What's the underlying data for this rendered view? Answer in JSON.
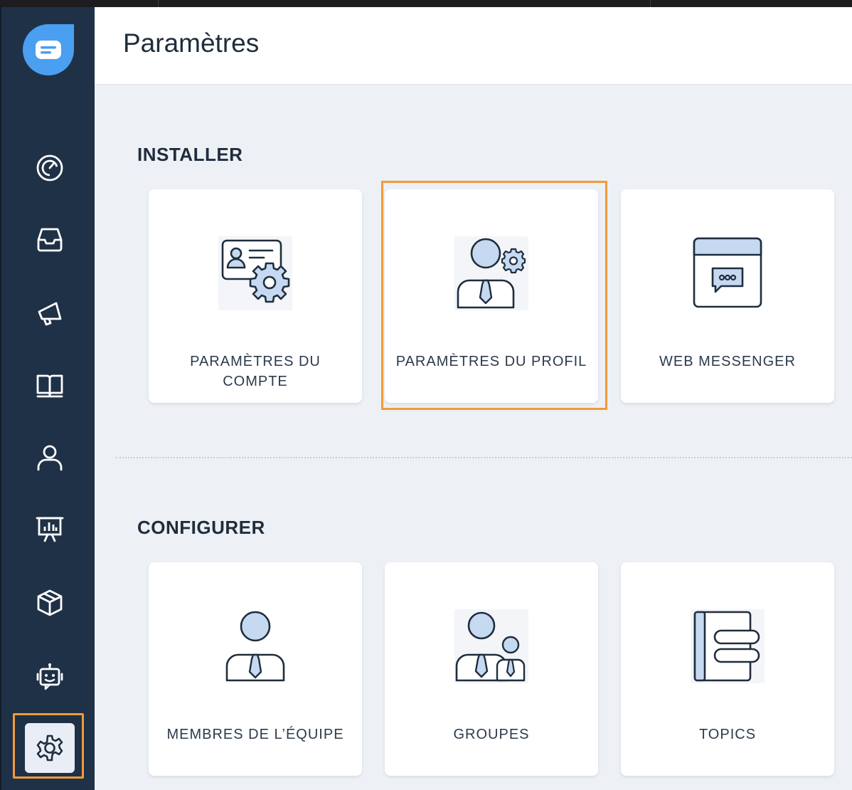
{
  "page": {
    "title": "Paramètres"
  },
  "sidebar": {
    "items": [
      {
        "id": "dashboard",
        "icon": "dashboard-gauge-icon"
      },
      {
        "id": "inbox",
        "icon": "inbox-tray-icon"
      },
      {
        "id": "campaigns",
        "icon": "megaphone-icon"
      },
      {
        "id": "knowledge",
        "icon": "open-book-icon"
      },
      {
        "id": "contacts",
        "icon": "person-icon"
      },
      {
        "id": "reports",
        "icon": "presentation-chart-icon"
      },
      {
        "id": "integrations",
        "icon": "cube-icon"
      },
      {
        "id": "bots",
        "icon": "robot-icon"
      },
      {
        "id": "settings",
        "icon": "gear-icon",
        "active": true
      }
    ]
  },
  "sections": {
    "install": {
      "title": "INSTALLER",
      "cards": [
        {
          "label": "PARAMÈTRES DU COMPTE",
          "icon": "account-settings-icon"
        },
        {
          "label": "PARAMÈTRES DU PROFIL",
          "icon": "profile-settings-icon",
          "highlighted": true
        },
        {
          "label": "WEB MESSENGER",
          "icon": "web-messenger-icon"
        }
      ]
    },
    "configure": {
      "title": "CONFIGURER",
      "cards": [
        {
          "label": "MEMBRES DE L’ÉQUIPE",
          "icon": "team-member-icon"
        },
        {
          "label": "GROUPES",
          "icon": "groups-icon"
        },
        {
          "label": "TOPICS",
          "icon": "topics-icon"
        }
      ]
    }
  },
  "colors": {
    "sidebar": "#1f3147",
    "accent_blue": "#4a90e2",
    "highlight": "#f19a3a",
    "illustration_fill": "#c5d9f1",
    "illustration_stroke": "#1f2d3d"
  }
}
